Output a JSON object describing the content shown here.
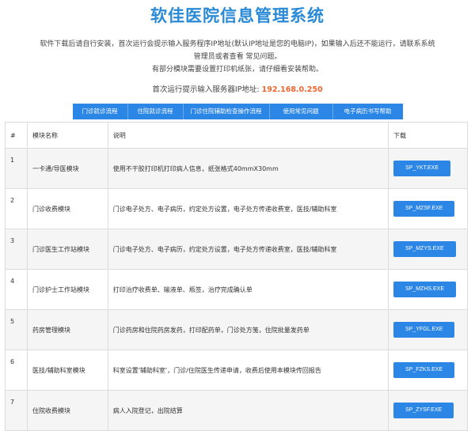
{
  "title": "软佳医院信息管理系统",
  "description": [
    "软件下载后请自行安装，首次运行会提示输入服务程序IP地址(默认IP地址是您的电脑IP)，如果输入后还不能运行，请联系系统",
    "管理员或者查看 常见问题。",
    "有部分模块需要设置打印机纸张，请仔细看安装帮助。"
  ],
  "server": {
    "label": "首次运行提示输入服务器IP地址:",
    "ip": "192.168.0.250"
  },
  "tabs": [
    {
      "label": "门诊就诊流程"
    },
    {
      "label": "住院就诊流程"
    },
    {
      "label": "门诊住院辅助检查操作流程"
    },
    {
      "label": "使用常见问题"
    },
    {
      "label": "电子病历书写帮助"
    }
  ],
  "table": {
    "headers": {
      "num": "#",
      "name": "模块名称",
      "desc": "说明",
      "download": "下载"
    },
    "rows": [
      {
        "num": "1",
        "name": "一卡通/导医模块",
        "desc": "使用不干胶打印机打印病人信息，纸张格式40mmX30mm",
        "file": "SP_YKT.EXE"
      },
      {
        "num": "2",
        "name": "门诊收费模块",
        "desc": "门诊电子处方、电子病历，约定处方设置，电子处方传递收费室，医技/辅助科室",
        "file": "SP_MZSF.EXE"
      },
      {
        "num": "3",
        "name": "门诊医生工作站模块",
        "desc": "门诊电子处方、电子病历，约定处方设置，电子处方传递收费室，医技/辅助科室",
        "file": "SP_MZYS.EXE"
      },
      {
        "num": "4",
        "name": "门诊护士工作站模块",
        "desc": "打印治疗收费单、输液单、瓶签，治疗完成确认单",
        "file": "SP_MZHS.EXE"
      },
      {
        "num": "5",
        "name": "药房管理模块",
        "desc": "门诊药房和住院药房发药，打印配药单，门诊处方笺，住院批量发药单",
        "file": "SP_YFGL.EXE"
      },
      {
        "num": "6",
        "name": "医技/辅助科室模块",
        "desc": "科室设置'辅助科室'，门诊/住院医生传递申请，收费后使用本模块传回报告",
        "file": "SP_FZKS.EXE"
      },
      {
        "num": "7",
        "name": "住院收费模块",
        "desc": "病人入院登记，出院结算",
        "file": "SP_ZYSF.EXE"
      }
    ]
  }
}
